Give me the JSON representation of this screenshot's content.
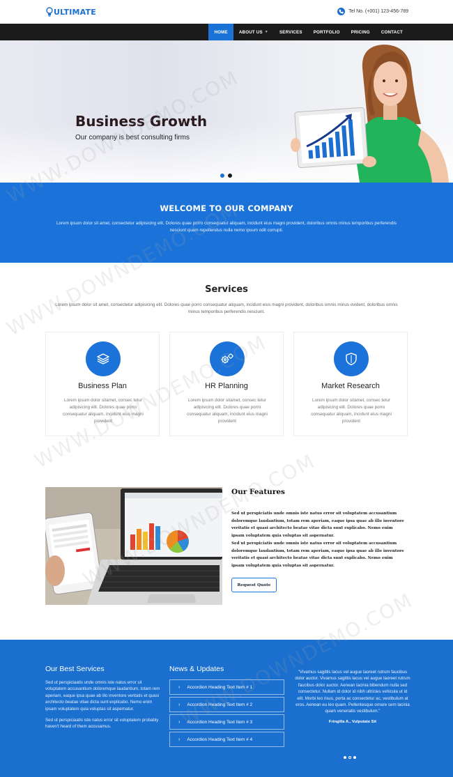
{
  "header": {
    "logo_text": "ULTIMATE",
    "phone": "Tel No. (+001) 123-456-789"
  },
  "nav": {
    "items": [
      {
        "label": "HOME",
        "active": true
      },
      {
        "label": "ABOUT US",
        "active": false
      },
      {
        "label": "SERVICES",
        "active": false
      },
      {
        "label": "PORTFOLIO",
        "active": false
      },
      {
        "label": "PRICING",
        "active": false
      },
      {
        "label": "CONTACT",
        "active": false
      }
    ]
  },
  "hero": {
    "title": "Business Growth",
    "subtitle": "Our company is best consulting firms",
    "slides": 3,
    "active_slide": 2
  },
  "welcome": {
    "title": "WELCOME TO OUR COMPANY",
    "text": "Lorem ipsum dolor sit amet, consectetur adipisicing elit. Dolores quae porro consequatur aliquam, incidunt eius magni provident, doloribus omnis minus temporibus perferendis nesciunt quam repellendus nulla nemo ipsum odit corrupti."
  },
  "services": {
    "title": "Services",
    "description": "Lorem ipsum dolor sit amet, consectetur adipisicing elit. Dolores quae porro consequatur aliquam, incidunt eius magni provident, doloribus omnis minus ovident, doloribus omnis minus temporibus perferendis nesciunt.",
    "cards": [
      {
        "icon": "layers-icon",
        "title": "Business Plan",
        "text": "Lorem ipsum dolor sitamet, consec tetur adipisicing elit. Dolores quae porro consequatur aliquam, incidunt eius magni provident"
      },
      {
        "icon": "gears-icon",
        "title": "HR Planning",
        "text": "Lorem ipsum dolor sitamet, consec tetur adipisicing elit. Dolores quae porro consequatur aliquam, incidunt eius magni provident"
      },
      {
        "icon": "shield-icon",
        "title": "Market Research",
        "text": "Lorem ipsum dolor sitamet, consec tetur adipisicing elit. Dolores quae porro consequatur aliquam, incidunt eius magni provident"
      }
    ]
  },
  "features": {
    "title": "Our Features",
    "para1": "Sed ut perspiciatis unde omnis iste natus error sit voluptatem accusantium doloremque laudantium, totam rem aperiam, eaque ipsa quae ab illo inventore veritatis et quasi architecto beatae vitae dicta sunt explicabo. Nemo enim ipsam voluptatem quia voluptas sit aspernatur.",
    "para2": "Sed ut perspiciatis unde omnis iste natus error sit voluptatem accusantium doloremque laudantium, totam rem aperiam, eaque ipsa quae ab illo inventore veritatis et quasi architecto beatae vitae dicta sunt explicabo. Nemo enim ipsam voluptatem quia voluptas sit aspernatur.",
    "button_label": "Request Quote"
  },
  "footer": {
    "col1": {
      "title": "Our Best Services",
      "para1": "Sed ut perspiciaatis unde omnis iste natus error sit voluptatem accusantium doloremque laudantium, totam rem aperiam, eaque ipsa quae ab illo inventore veritatis et quasi architecto beatae vitae dicta sunt explicabo. Nemo enim ipsam voluptatem quia voluptas sit aspernatur.",
      "para2": "Sed ut perspiciaatis iste natus error sit voluptatem probably haven't heard of them accusamus."
    },
    "col2": {
      "title": "News & Updates",
      "items": [
        "Accordion Heading Text Item # 1",
        "Accordion Heading Text Item # 2",
        "Accordion Heading Text Item # 3",
        "Accordion Heading Text Item # 4"
      ]
    },
    "testimonial": {
      "quote": "\"Vivamus sagittis lacus vel augue laoreet rutrum faucibus dolor auctor. Vivamus sagittis lacus vel augue laoreet rutrum faucibus dolor auctor. Aenean lacinia bibendum nulla sed consectetur. Nullam id dolor id nibh ultricies vehicula ut id elit. Morbi leo risus, porta ac consectetur ac, vestibulum at eros. Aenean eu leo quam. Pellentesque ornare sem lacinia quam venenatis vestibulum.\"",
      "author": "Fringilla A., Vulputate Sit"
    }
  },
  "watermark": "WWW.DOWNDEMO.COM",
  "colors": {
    "accent": "#1b73d9",
    "nav_bg": "#1b1b1b",
    "footer_bg": "#1a6fcf"
  }
}
